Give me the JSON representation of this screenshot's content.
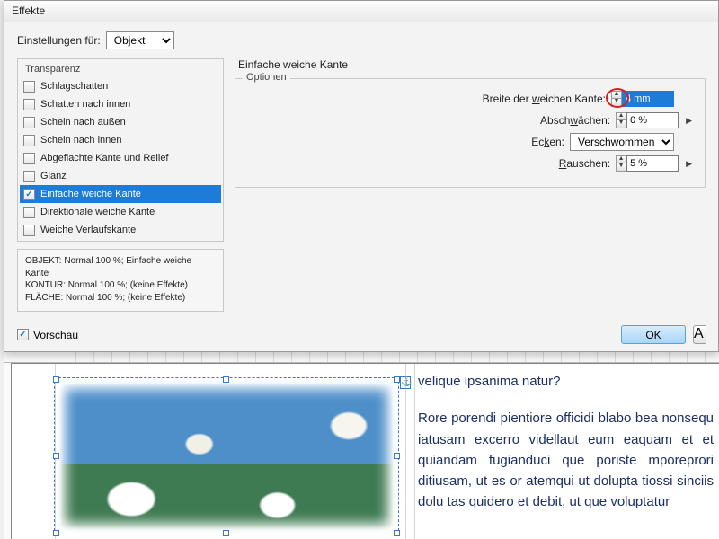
{
  "dialog": {
    "title": "Effekte",
    "settings_for_label": "Einstellungen für:",
    "settings_for_value": "Objekt",
    "preview_label": "Vorschau",
    "ok_label": "OK",
    "cancel_partial": "A"
  },
  "effects_group": {
    "title": "Transparenz",
    "items": [
      {
        "label": "Schlagschatten",
        "checked": false,
        "selected": false
      },
      {
        "label": "Schatten nach innen",
        "checked": false,
        "selected": false
      },
      {
        "label": "Schein nach außen",
        "checked": false,
        "selected": false
      },
      {
        "label": "Schein nach innen",
        "checked": false,
        "selected": false
      },
      {
        "label": "Abgeflachte Kante und Relief",
        "checked": false,
        "selected": false
      },
      {
        "label": "Glanz",
        "checked": false,
        "selected": false
      },
      {
        "label": "Einfache weiche Kante",
        "checked": true,
        "selected": true
      },
      {
        "label": "Direktionale weiche Kante",
        "checked": false,
        "selected": false
      },
      {
        "label": "Weiche Verlaufskante",
        "checked": false,
        "selected": false
      }
    ]
  },
  "summary": {
    "line1": "OBJEKT: Normal 100 %; Einfache weiche Kante",
    "line2": "KONTUR: Normal 100 %; (keine Effekte)",
    "line3": "FLÄCHE: Normal 100 %; (keine Effekte)"
  },
  "panel": {
    "heading": "Einfache weiche Kante",
    "group_label": "Optionen",
    "width_label_pre": "Breite der ",
    "width_label_u": "w",
    "width_label_post": "eichen Kante:",
    "width_value": "4 mm",
    "atten_label_pre": "Absch",
    "atten_label_u": "w",
    "atten_label_post": "ächen:",
    "atten_value": "0 %",
    "corners_label_pre": "Ec",
    "corners_label_u": "k",
    "corners_label_post": "en:",
    "corners_value": "Verschwommen",
    "noise_label_u": "R",
    "noise_label_post": "auschen:",
    "noise_value": "5 %"
  },
  "document": {
    "heading_fragment": "velique ipsanima natur?",
    "body": "Rore porendi pientiore officidi blabo bea nonsequ iatusam excerro videllaut eum eaquam et et quiandam fugianduci que poriste mporeprori ditiusam, ut es or atemqui ut dolupta tiossi sinciis dolu tas quidero et debit, ut que voluptatur",
    "anchor_glyph": "⚓"
  }
}
